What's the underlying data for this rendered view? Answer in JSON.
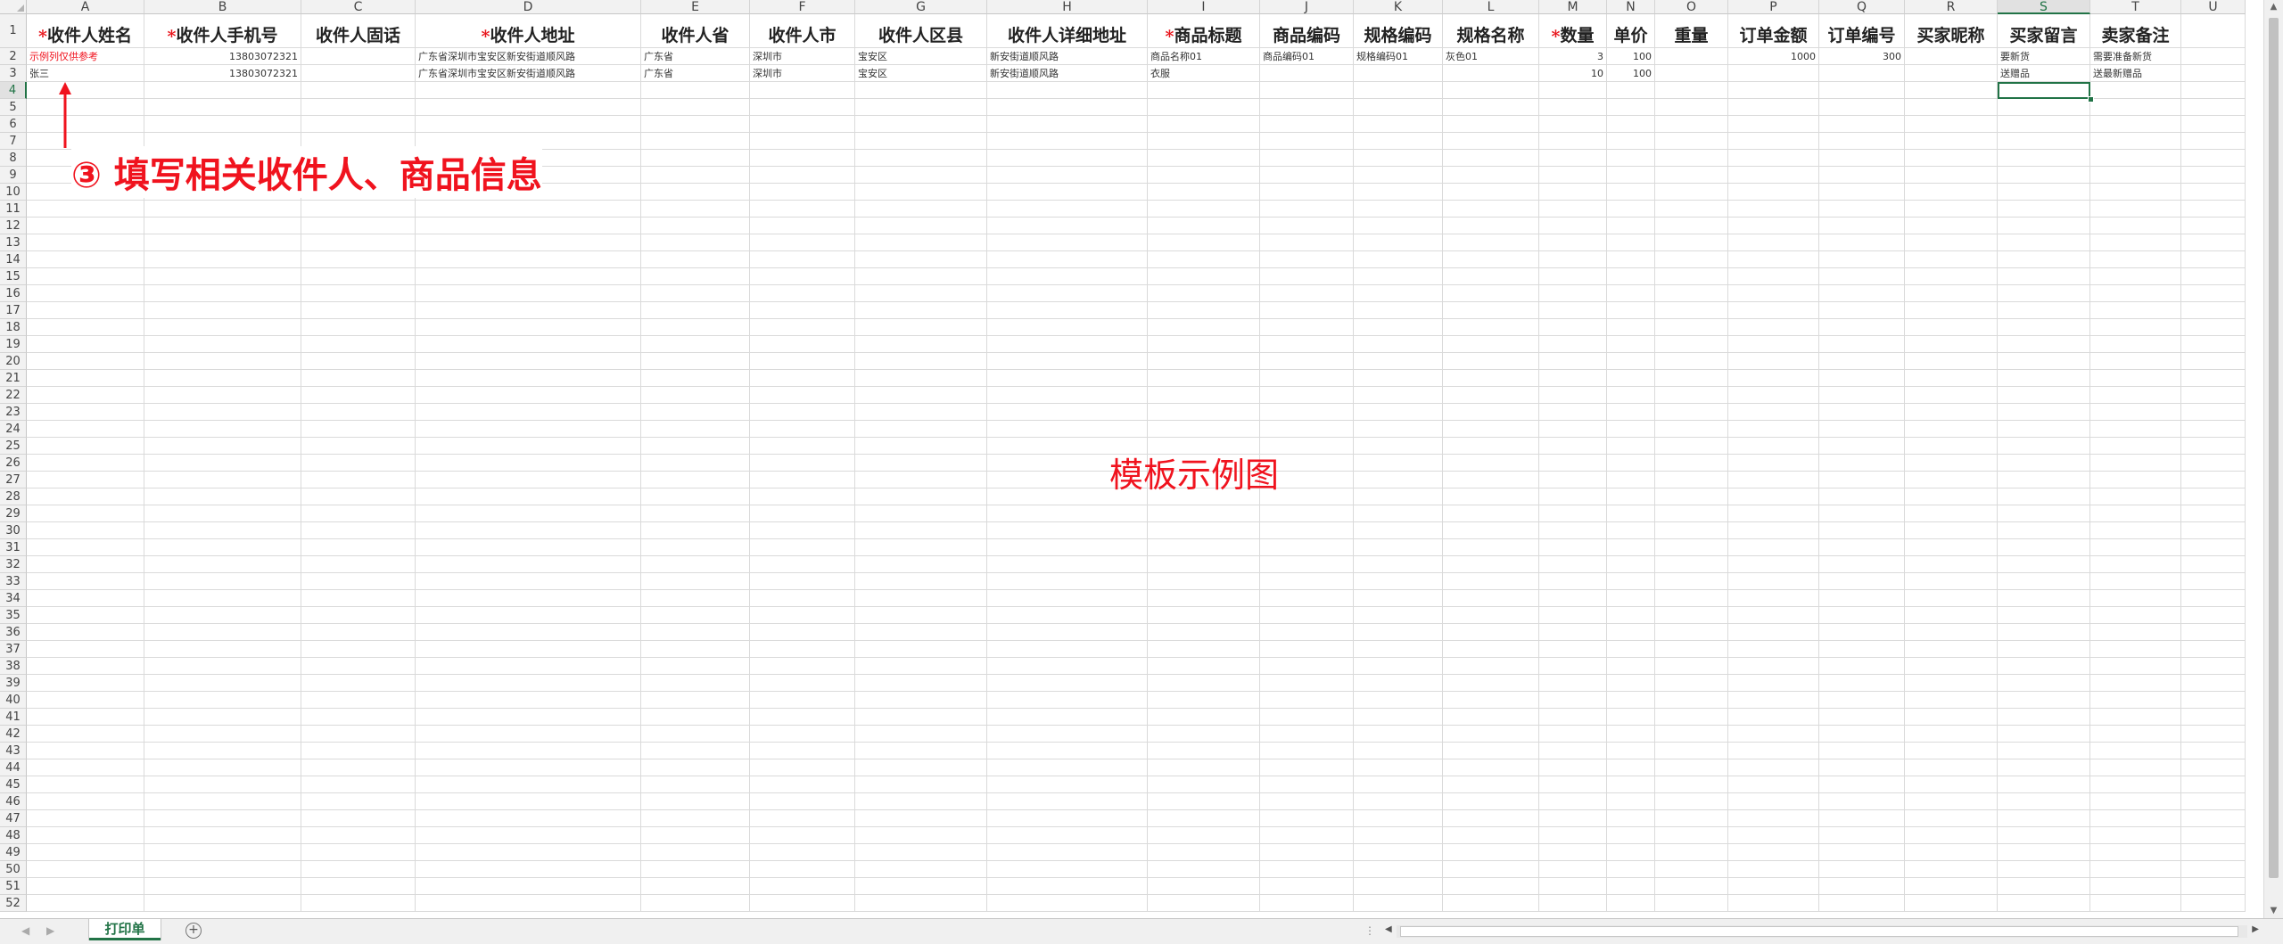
{
  "sheet": {
    "columns": [
      "A",
      "B",
      "C",
      "D",
      "E",
      "F",
      "G",
      "H",
      "I",
      "J",
      "K",
      "L",
      "M",
      "N",
      "O",
      "P",
      "Q",
      "R",
      "S",
      "T",
      "U"
    ],
    "selected_column": "S",
    "selected_row": 4,
    "row_count": 52,
    "headers": [
      {
        "req": "*",
        "label": "收件人姓名"
      },
      {
        "req": "*",
        "label": "收件人手机号"
      },
      {
        "req": "",
        "label": "收件人固话"
      },
      {
        "req": "*",
        "label": "收件人地址"
      },
      {
        "req": "",
        "label": "收件人省"
      },
      {
        "req": "",
        "label": "收件人市"
      },
      {
        "req": "",
        "label": "收件人区县"
      },
      {
        "req": "",
        "label": "收件人详细地址"
      },
      {
        "req": "*",
        "label": "商品标题"
      },
      {
        "req": "",
        "label": "商品编码"
      },
      {
        "req": "",
        "label": "规格编码"
      },
      {
        "req": "",
        "label": "规格名称"
      },
      {
        "req": "*",
        "label": "数量"
      },
      {
        "req": "",
        "label": "单价"
      },
      {
        "req": "",
        "label": "重量"
      },
      {
        "req": "",
        "label": "订单金额"
      },
      {
        "req": "",
        "label": "订单编号"
      },
      {
        "req": "",
        "label": "买家昵称"
      },
      {
        "req": "",
        "label": "买家留言"
      },
      {
        "req": "",
        "label": "卖家备注"
      },
      {
        "req": "",
        "label": ""
      }
    ],
    "rows": [
      [
        "示例列仅供参考",
        "13803072321",
        "",
        "广东省深圳市宝安区新安街道顺风路",
        "广东省",
        "深圳市",
        "宝安区",
        "新安街道顺风路",
        "商品名称01",
        "商品编码01",
        "规格编码01",
        "灰色01",
        "3",
        "100",
        "",
        "1000",
        "300",
        "",
        "要新货",
        "需要准备新货",
        ""
      ],
      [
        "张三",
        "13803072321",
        "",
        "广东省深圳市宝安区新安街道顺风路",
        "广东省",
        "深圳市",
        "宝安区",
        "新安街道顺风路",
        "衣服",
        "",
        "",
        "",
        "10",
        "100",
        "",
        "",
        "",
        "",
        "送赠品",
        "送最新赠品",
        ""
      ]
    ]
  },
  "annotation": "③ 填写相关收件人、商品信息",
  "watermark": "模板示例图",
  "sheet_tab": "打印单",
  "add_sheet_label": "+",
  "colors": {
    "accent": "#217346",
    "annotation": "#f0131e"
  }
}
